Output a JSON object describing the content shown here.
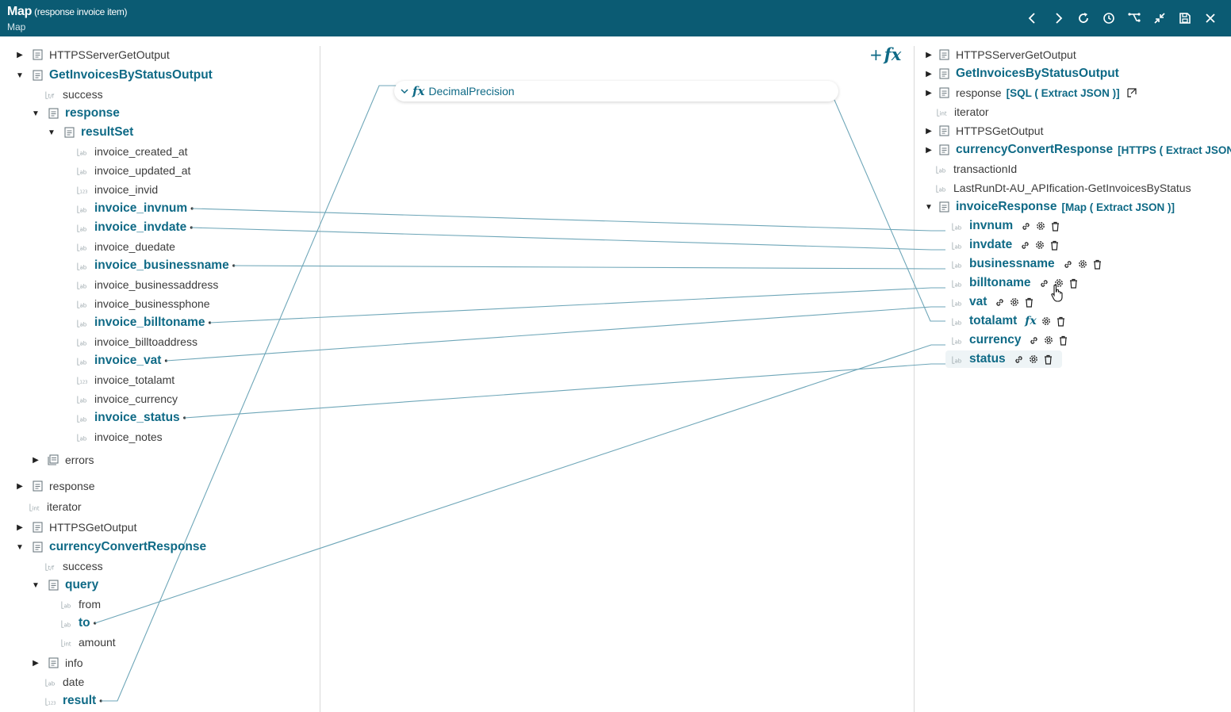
{
  "header": {
    "title": "Map",
    "subtitle": "(response invoice item)",
    "breadcrumb": "Map"
  },
  "header_icons": [
    "chevron-left-icon",
    "chevron-right-icon",
    "refresh-icon",
    "history-icon",
    "share-tree-icon",
    "collapse-icon",
    "save-icon",
    "close-icon"
  ],
  "colors": {
    "header": "#0b5b73",
    "accent": "#0f6a86",
    "wire": "#6ea6b8"
  },
  "function_box": {
    "name": "DecimalPrecision"
  },
  "source_tree": [
    {
      "id": "s0",
      "label": "HTTPSServerGetOutput",
      "icon": "doc",
      "toggle": "collapsed",
      "mapped": false
    },
    {
      "id": "s1",
      "label": "GetInvoicesByStatusOutput",
      "icon": "doc",
      "toggle": "expanded",
      "mapped": true
    },
    {
      "id": "s2",
      "label": "success",
      "icon": "bool",
      "mapped": false
    },
    {
      "id": "s3",
      "label": "response",
      "icon": "doc",
      "toggle": "expanded",
      "mapped": true
    },
    {
      "id": "s4",
      "label": "resultSet",
      "icon": "doc",
      "toggle": "expanded",
      "mapped": true
    },
    {
      "id": "s5",
      "label": "invoice_created_at",
      "icon": "ab",
      "mapped": false
    },
    {
      "id": "s6",
      "label": "invoice_updated_at",
      "icon": "ab",
      "mapped": false
    },
    {
      "id": "s7",
      "label": "invoice_invid",
      "icon": "dec",
      "mapped": false
    },
    {
      "id": "s8",
      "label": "invoice_invnum",
      "icon": "ab",
      "mapped": true,
      "conn": true
    },
    {
      "id": "s9",
      "label": "invoice_invdate",
      "icon": "ab",
      "mapped": true,
      "conn": true
    },
    {
      "id": "s10",
      "label": "invoice_duedate",
      "icon": "ab",
      "mapped": false
    },
    {
      "id": "s11",
      "label": "invoice_businessname",
      "icon": "ab",
      "mapped": true,
      "conn": true
    },
    {
      "id": "s12",
      "label": "invoice_businessaddress",
      "icon": "ab",
      "mapped": false
    },
    {
      "id": "s13",
      "label": "invoice_businessphone",
      "icon": "ab",
      "mapped": false
    },
    {
      "id": "s14",
      "label": "invoice_billtoname",
      "icon": "ab",
      "mapped": true,
      "conn": true
    },
    {
      "id": "s15",
      "label": "invoice_billtoaddress",
      "icon": "ab",
      "mapped": false
    },
    {
      "id": "s16",
      "label": "invoice_vat",
      "icon": "ab",
      "mapped": true,
      "conn": true
    },
    {
      "id": "s17",
      "label": "invoice_totalamt",
      "icon": "dec",
      "mapped": false
    },
    {
      "id": "s18",
      "label": "invoice_currency",
      "icon": "ab",
      "mapped": false
    },
    {
      "id": "s19",
      "label": "invoice_status",
      "icon": "ab",
      "mapped": true,
      "conn": true
    },
    {
      "id": "s20",
      "label": "invoice_notes",
      "icon": "ab",
      "mapped": false
    },
    {
      "id": "s21",
      "label": "errors",
      "icon": "list",
      "toggle": "collapsed",
      "mapped": false
    },
    {
      "id": "s22",
      "label": "response",
      "icon": "doc",
      "toggle": "collapsed",
      "mapped": false
    },
    {
      "id": "s23",
      "label": "iterator",
      "icon": "int",
      "mapped": false
    },
    {
      "id": "s24",
      "label": "HTTPSGetOutput",
      "icon": "doc",
      "toggle": "collapsed",
      "mapped": false
    },
    {
      "id": "s25",
      "label": "currencyConvertResponse",
      "icon": "doc",
      "toggle": "expanded",
      "mapped": true
    },
    {
      "id": "s26",
      "label": "success",
      "icon": "bool",
      "mapped": false
    },
    {
      "id": "s27",
      "label": "query",
      "icon": "doc",
      "toggle": "expanded",
      "mapped": true
    },
    {
      "id": "s28",
      "label": "from",
      "icon": "ab",
      "mapped": false
    },
    {
      "id": "s29",
      "label": "to",
      "icon": "ab",
      "mapped": true,
      "conn": true
    },
    {
      "id": "s30",
      "label": "amount",
      "icon": "int",
      "mapped": false
    },
    {
      "id": "s31",
      "label": "info",
      "icon": "doc",
      "toggle": "collapsed",
      "mapped": false
    },
    {
      "id": "s32",
      "label": "date",
      "icon": "ab",
      "mapped": false
    },
    {
      "id": "s33",
      "label": "result",
      "icon": "dec",
      "mapped": true,
      "conn": true
    }
  ],
  "target_tree": [
    {
      "id": "t0",
      "label": "HTTPSServerGetOutput",
      "icon": "doc",
      "toggle": "collapsed",
      "mapped": false
    },
    {
      "id": "t1",
      "label": "GetInvoicesByStatusOutput",
      "icon": "doc",
      "toggle": "collapsed",
      "mapped": true
    },
    {
      "id": "t2",
      "label": "response",
      "suffix": "[SQL ( Extract JSON )]",
      "icon": "doc",
      "toggle": "collapsed",
      "mapped": false,
      "extra": "link-out-icon"
    },
    {
      "id": "t3",
      "label": "iterator",
      "icon": "int",
      "mapped": false
    },
    {
      "id": "t4",
      "label": "HTTPSGetOutput",
      "icon": "doc",
      "toggle": "collapsed",
      "mapped": false
    },
    {
      "id": "t5",
      "label": "currencyConvertResponse",
      "suffix": "[HTTPS ( Extract JSON",
      "icon": "doc",
      "toggle": "collapsed",
      "mapped": true
    },
    {
      "id": "t6",
      "label": "transactionId",
      "icon": "ab",
      "mapped": false
    },
    {
      "id": "t7",
      "label": "LastRunDt-AU_APIfication-GetInvoicesByStatus",
      "icon": "ab",
      "mapped": false
    },
    {
      "id": "t8",
      "label": "invoiceResponse",
      "suffix": "[Map ( Extract JSON )]",
      "icon": "doc",
      "toggle": "expanded",
      "mapped": true
    },
    {
      "id": "t9",
      "label": "invnum",
      "icon": "ab",
      "mapped": true,
      "actions": [
        "link",
        "gear",
        "trash"
      ]
    },
    {
      "id": "t10",
      "label": "invdate",
      "icon": "ab",
      "mapped": true,
      "actions": [
        "link",
        "gear",
        "trash"
      ]
    },
    {
      "id": "t11",
      "label": "businessname",
      "icon": "ab",
      "mapped": true,
      "actions": [
        "link",
        "gear",
        "trash"
      ]
    },
    {
      "id": "t12",
      "label": "billtoname",
      "icon": "ab",
      "mapped": true,
      "actions": [
        "link",
        "gear",
        "trash"
      ]
    },
    {
      "id": "t13",
      "label": "vat",
      "icon": "ab",
      "mapped": true,
      "actions": [
        "link",
        "gear",
        "trash"
      ]
    },
    {
      "id": "t14",
      "label": "totalamt",
      "icon": "ab",
      "mapped": true,
      "actions": [
        "fx",
        "gear",
        "trash"
      ]
    },
    {
      "id": "t15",
      "label": "currency",
      "icon": "ab",
      "mapped": true,
      "actions": [
        "link",
        "gear",
        "trash"
      ]
    },
    {
      "id": "t16",
      "label": "status",
      "icon": "ab",
      "mapped": true,
      "actions": [
        "link",
        "gear",
        "trash"
      ],
      "highlight": true
    }
  ],
  "connections": [
    {
      "from": "s8",
      "to": "t9"
    },
    {
      "from": "s9",
      "to": "t10"
    },
    {
      "from": "s11",
      "to": "t11"
    },
    {
      "from": "s14",
      "to": "t12"
    },
    {
      "from": "s16",
      "to": "t13"
    },
    {
      "from": "s19",
      "to": "t16"
    },
    {
      "from": "s29",
      "to": "t15"
    },
    {
      "from": "s33",
      "to": "fn",
      "fn": "DecimalPrecision"
    },
    {
      "from": "fn",
      "to": "t14",
      "fn": "DecimalPrecision"
    }
  ]
}
